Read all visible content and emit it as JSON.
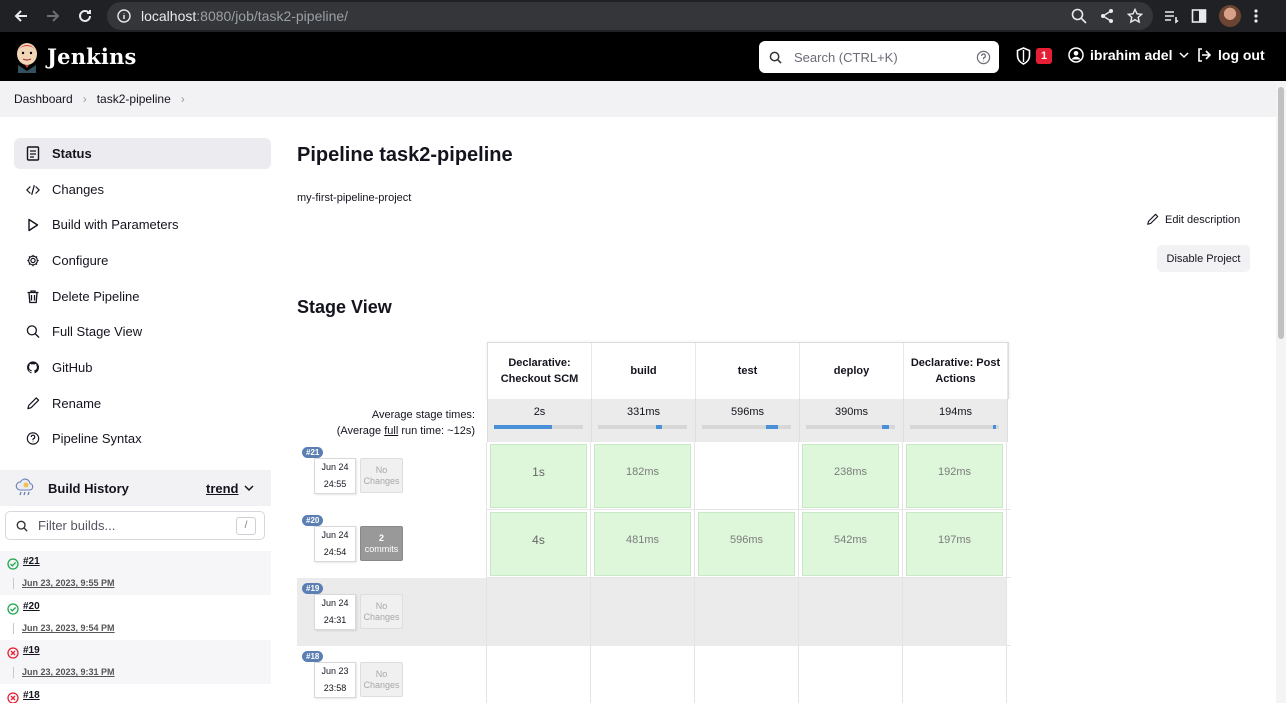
{
  "browser": {
    "url_host": "localhost",
    "url_rest": ":8080/job/task2-pipeline/"
  },
  "header": {
    "brand": "Jenkins",
    "search_placeholder": "Search (CTRL+K)",
    "security_count": "1",
    "user_name": "ibrahim adel",
    "logout_label": "log out"
  },
  "breadcrumbs": [
    "Dashboard",
    "task2-pipeline"
  ],
  "sidebar": {
    "items": [
      {
        "label": "Status",
        "icon": "status-icon"
      },
      {
        "label": "Changes",
        "icon": "code-icon"
      },
      {
        "label": "Build with Parameters",
        "icon": "play-icon"
      },
      {
        "label": "Configure",
        "icon": "gear-icon"
      },
      {
        "label": "Delete Pipeline",
        "icon": "trash-icon"
      },
      {
        "label": "Full Stage View",
        "icon": "search-icon"
      },
      {
        "label": "GitHub",
        "icon": "github-icon"
      },
      {
        "label": "Rename",
        "icon": "pencil-icon"
      },
      {
        "label": "Pipeline Syntax",
        "icon": "help-icon"
      }
    ]
  },
  "build_history": {
    "title": "Build History",
    "trend_label": "trend",
    "filter_placeholder": "Filter builds...",
    "filter_shortcut": "/",
    "builds": [
      {
        "number": "#21",
        "date": "Jun 23, 2023, 9:55 PM",
        "status": "success"
      },
      {
        "number": "#20",
        "date": "Jun 23, 2023, 9:54 PM",
        "status": "success"
      },
      {
        "number": "#19",
        "date": "Jun 23, 2023, 9:31 PM",
        "status": "failed"
      },
      {
        "number": "#18",
        "date": "",
        "status": "failed"
      }
    ]
  },
  "main": {
    "title": "Pipeline task2-pipeline",
    "description": "my-first-pipeline-project",
    "edit_description_label": "Edit description",
    "disable_button_label": "Disable Project",
    "stage_view_title": "Stage View"
  },
  "stage_view": {
    "stages": [
      "Declarative: Checkout SCM",
      "build",
      "test",
      "deploy",
      "Declarative: Post Actions"
    ],
    "avg_label_line1": "Average stage times:",
    "avg_label_line2_pre": "(Average ",
    "avg_label_line2_u": "full",
    "avg_label_line2_post": " run time: ~12s)",
    "avg_times": [
      "2s",
      "331ms",
      "596ms",
      "390ms",
      "194ms"
    ],
    "avg_bars": [
      {
        "start": 0.0,
        "width": 0.65
      },
      {
        "start": 0.65,
        "width": 0.07
      },
      {
        "start": 0.72,
        "width": 0.13
      },
      {
        "start": 0.85,
        "width": 0.08
      },
      {
        "start": 0.93,
        "width": 0.04
      }
    ],
    "runs": [
      {
        "number": "#21",
        "date": "Jun 24",
        "time": "24:55",
        "changes": "No Changes",
        "commits": "",
        "cells": [
          "1s",
          "182ms",
          "",
          "238ms",
          "192ms"
        ]
      },
      {
        "number": "#20",
        "date": "Jun 24",
        "time": "24:54",
        "changes": "",
        "commits": "2",
        "commits_label": "commits",
        "cells": [
          "4s",
          "481ms",
          "596ms",
          "542ms",
          "197ms"
        ]
      },
      {
        "number": "#19",
        "date": "Jun 24",
        "time": "24:31",
        "changes": "No Changes",
        "commits": "",
        "cells": [
          "",
          "",
          "",
          "",
          ""
        ]
      },
      {
        "number": "#18",
        "date": "Jun 23",
        "time": "23:58",
        "changes": "No Changes",
        "commits": "",
        "cells": [
          "",
          "",
          "",
          "",
          ""
        ]
      }
    ]
  },
  "colors": {
    "success_fill": "#def7db",
    "build_badge": "#5b7fb3",
    "progress_bar": "#4a90d9",
    "failed_icon": "#e61f35",
    "success_icon": "#1ea64b"
  }
}
